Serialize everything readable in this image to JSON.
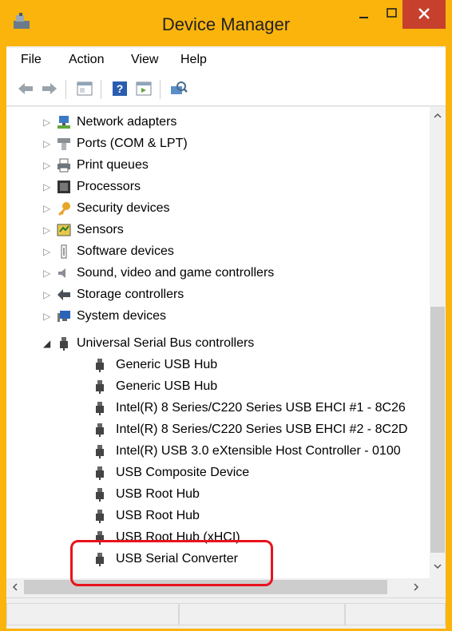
{
  "window": {
    "title": "Device Manager",
    "frame_color": "#fbb40c",
    "close_color": "#c7402e"
  },
  "menu": {
    "items": [
      "File",
      "Action",
      "View",
      "Help"
    ]
  },
  "toolbar": {
    "icons": [
      "back-arrow-icon",
      "forward-arrow-icon",
      "properties-icon",
      "help-icon",
      "update-driver-icon",
      "scan-hardware-icon"
    ]
  },
  "tree": {
    "collapsed_categories": [
      "Network adapters",
      "Ports (COM & LPT)",
      "Print queues",
      "Processors",
      "Security devices",
      "Sensors",
      "Software devices",
      "Sound, video and game controllers",
      "Storage controllers",
      "System devices"
    ],
    "expanded_category": "Universal Serial Bus controllers",
    "usb_devices": [
      "Generic USB Hub",
      "Generic USB Hub",
      "Intel(R) 8 Series/C220 Series USB EHCI #1 - 8C26",
      "Intel(R) 8 Series/C220 Series USB EHCI #2 - 8C2D",
      "Intel(R) USB 3.0 eXtensible Host Controller - 0100",
      "USB Composite Device",
      "USB Root Hub",
      "USB Root Hub",
      "USB Root Hub (xHCI)",
      "USB Serial Converter"
    ]
  },
  "highlight_color": "#e8131c"
}
